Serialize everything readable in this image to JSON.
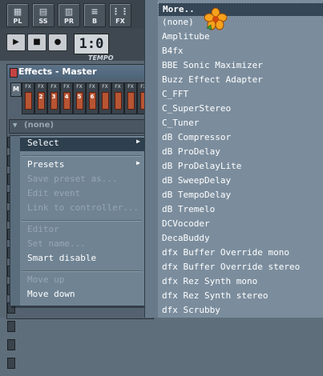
{
  "toolbar": {
    "buttons": [
      {
        "label": "PL",
        "icon": "playlist-icon"
      },
      {
        "label": "SS",
        "icon": "step-sequencer-icon"
      },
      {
        "label": "PR",
        "icon": "piano-roll-icon"
      },
      {
        "label": "B",
        "icon": "browser-icon"
      },
      {
        "label": "FX",
        "icon": "mixer-icon"
      }
    ]
  },
  "transport": {
    "time_display": "1:0",
    "tempo_label": "TEMPO"
  },
  "effects_window": {
    "title": "Effects - Master",
    "mute_label": "M",
    "fx_tag": "FX",
    "slot_numbers": [
      "",
      "2",
      "3",
      "4",
      "5",
      "6",
      "",
      "",
      "",
      ""
    ],
    "slot_value": "(none)"
  },
  "context_menu": {
    "items": [
      {
        "label": "Select",
        "state": "selected",
        "submenu": true
      },
      {
        "label": "Presets",
        "state": "normal",
        "submenu": true
      },
      {
        "label": "Save preset as...",
        "state": "disabled",
        "submenu": false
      },
      {
        "label": "Edit event",
        "state": "disabled",
        "submenu": false
      },
      {
        "label": "Link to controller...",
        "state": "disabled",
        "submenu": false
      },
      {
        "label": "Editor",
        "state": "disabled",
        "submenu": false
      },
      {
        "label": "Set name...",
        "state": "disabled",
        "submenu": false
      },
      {
        "label": "Smart disable",
        "state": "normal",
        "submenu": false
      },
      {
        "label": "Move up",
        "state": "disabled",
        "submenu": false
      },
      {
        "label": "Move down",
        "state": "normal",
        "submenu": false
      }
    ]
  },
  "plugin_list": {
    "items": [
      "More..",
      "(none)",
      "Amplitube",
      "B4fx",
      "BBE Sonic Maximizer",
      "Buzz Effect Adapter",
      "C_FFT",
      "C_SuperStereo",
      "C_Tuner",
      "dB Compressor",
      "dB ProDelay",
      "dB ProDelayLite",
      "dB SweepDelay",
      "dB TempoDelay",
      "dB Tremelo",
      "DCVocoder",
      "DecaBuddy",
      "dfx Buffer Override mono",
      "dfx Buffer Override stereo",
      "dfx Rez Synth mono",
      "dfx Rez Synth stereo",
      "dfx Scrubby"
    ],
    "selected_index": 0
  }
}
